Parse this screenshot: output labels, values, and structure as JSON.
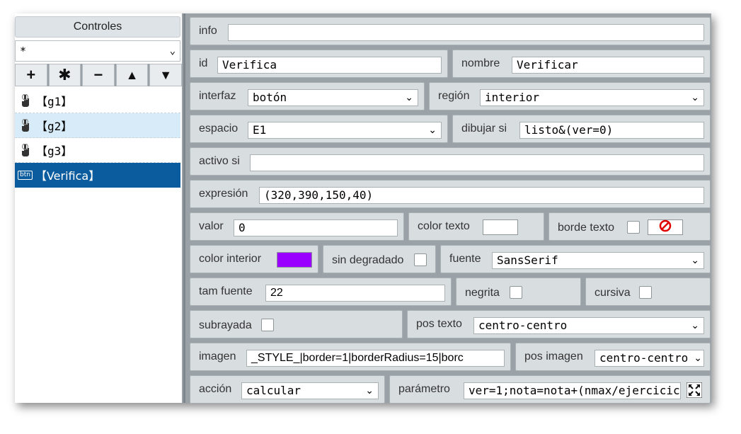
{
  "left": {
    "title": "Controles",
    "filter_value": "*",
    "toolbar": {
      "add": "+",
      "duplicate": "✱",
      "remove": "−",
      "up": "▲",
      "down": "▼"
    },
    "items": [
      {
        "label": "【g1】"
      },
      {
        "label": "【g2】"
      },
      {
        "label": "【g3】"
      },
      {
        "label": "【Verifica】",
        "badge": "btn"
      }
    ]
  },
  "form": {
    "info": {
      "label": "info",
      "value": ""
    },
    "id": {
      "label": "id",
      "value": "Verifica"
    },
    "nombre": {
      "label": "nombre",
      "value": "Verificar"
    },
    "interfaz": {
      "label": "interfaz",
      "value": "botón"
    },
    "region": {
      "label": "región",
      "value": "interior"
    },
    "espacio": {
      "label": "espacio",
      "value": "E1"
    },
    "dibujar_si": {
      "label": "dibujar si",
      "value": "listo&(ver=0)"
    },
    "activo_si": {
      "label": "activo si",
      "value": ""
    },
    "expresion": {
      "label": "expresión",
      "value": "(320,390,150,40)"
    },
    "valor": {
      "label": "valor",
      "value": "0"
    },
    "color_texto": {
      "label": "color texto",
      "color": "#ffffff"
    },
    "borde_texto": {
      "label": "borde texto"
    },
    "color_interior": {
      "label": "color interior",
      "color": "#9900ff"
    },
    "sin_degradado": {
      "label": "sin degradado"
    },
    "fuente": {
      "label": "fuente",
      "value": "SansSerif"
    },
    "tam_fuente": {
      "label": "tam fuente",
      "value": "22"
    },
    "negrita": {
      "label": "negrita"
    },
    "cursiva": {
      "label": "cursiva"
    },
    "subrayada": {
      "label": "subrayada"
    },
    "pos_texto": {
      "label": "pos texto",
      "value": "centro-centro"
    },
    "imagen": {
      "label": "imagen",
      "value": "_STYLE_|border=1|borderRadius=15|borc"
    },
    "pos_imagen": {
      "label": "pos imagen",
      "value": "centro-centro"
    },
    "accion": {
      "label": "acción",
      "value": "calcular"
    },
    "parametro": {
      "label": "parámetro",
      "value": "ver=1;nota=nota+(nmax/ejercicic"
    }
  },
  "colors": {
    "selected_item": "#0b5c9e",
    "hover_item": "#d7ecf8",
    "no_icon": "#e00000"
  }
}
